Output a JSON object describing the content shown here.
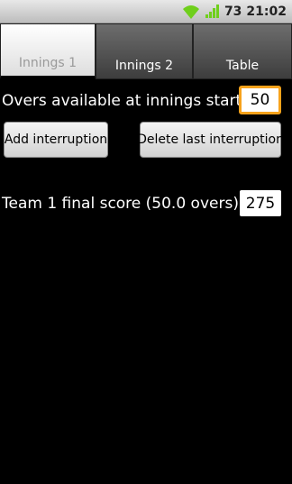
{
  "status_bar": {
    "battery_level": "73",
    "time": "21:02",
    "wifi_icon": "wifi-icon",
    "signal_icon": "signal-icon",
    "accent_color": "#6fcf1b"
  },
  "tabs": [
    {
      "label": "Innings 1",
      "selected": true
    },
    {
      "label": "Innings 2",
      "selected": false
    },
    {
      "label": "Table",
      "selected": false
    }
  ],
  "overs": {
    "label": "Overs available at innings start:",
    "value": "50"
  },
  "buttons": {
    "add_interruption": "Add interruption",
    "delete_last_interruption": "Delete last interruption"
  },
  "final_score": {
    "label": "Team 1 final score (50.0 overs):",
    "value": "275"
  },
  "colors": {
    "focus_border": "#f7a21b",
    "background": "#000000"
  }
}
